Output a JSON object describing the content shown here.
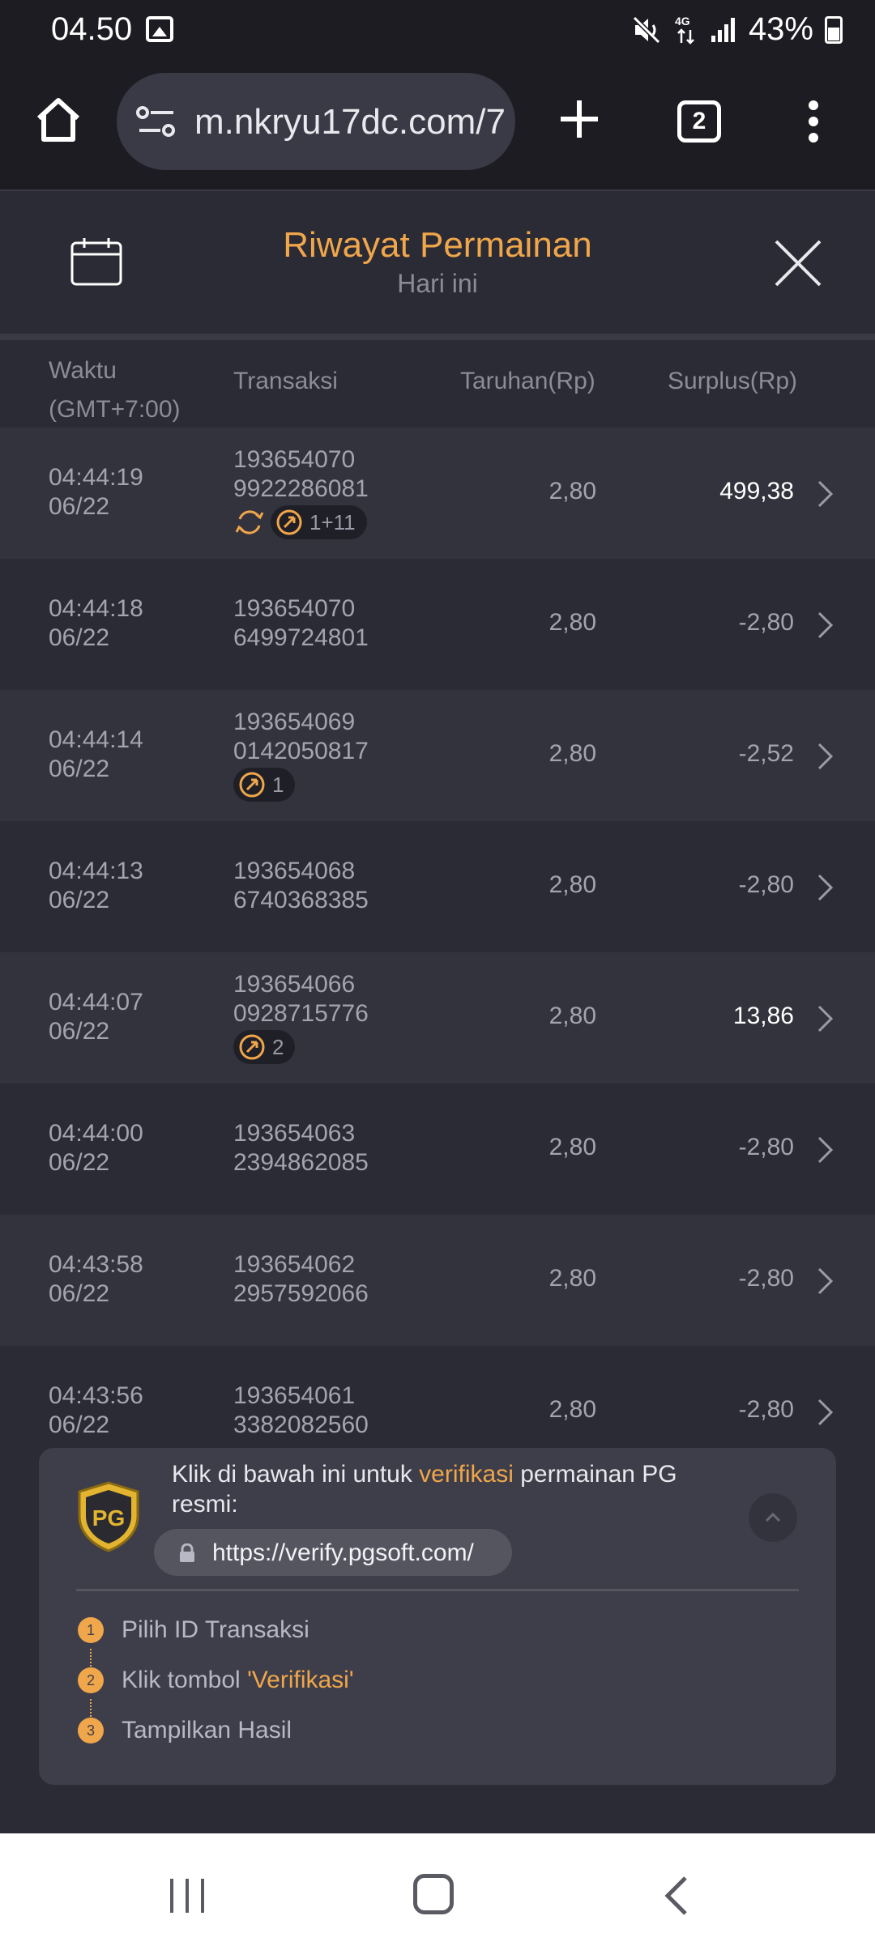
{
  "status_bar": {
    "time": "04.50",
    "network": "4G",
    "battery": "43%"
  },
  "browser": {
    "url": "m.nkryu17dc.com/7",
    "tab_count": "2"
  },
  "header": {
    "title": "Riwayat Permainan",
    "subtitle": "Hari ini"
  },
  "columns": {
    "time_line1": "Waktu",
    "time_line2": "(GMT+7:00)",
    "transaction": "Transaksi",
    "bet": "Taruhan(Rp)",
    "surplus": "Surplus(Rp)"
  },
  "rows": [
    {
      "time": "04:44:19",
      "date": "06/22",
      "tx1": "193654070",
      "tx2": "9922286081",
      "bet": "2,80",
      "surplus": "499,38",
      "badge": "1+11"
    },
    {
      "time": "04:44:18",
      "date": "06/22",
      "tx1": "193654070",
      "tx2": "6499724801",
      "bet": "2,80",
      "surplus": "-2,80"
    },
    {
      "time": "04:44:14",
      "date": "06/22",
      "tx1": "193654069",
      "tx2": "0142050817",
      "bet": "2,80",
      "surplus": "-2,52",
      "badge": "1"
    },
    {
      "time": "04:44:13",
      "date": "06/22",
      "tx1": "193654068",
      "tx2": "6740368385",
      "bet": "2,80",
      "surplus": "-2,80"
    },
    {
      "time": "04:44:07",
      "date": "06/22",
      "tx1": "193654066",
      "tx2": "0928715776",
      "bet": "2,80",
      "surplus": "13,86",
      "badge": "2"
    },
    {
      "time": "04:44:00",
      "date": "06/22",
      "tx1": "193654063",
      "tx2": "2394862085",
      "bet": "2,80",
      "surplus": "-2,80"
    },
    {
      "time": "04:43:58",
      "date": "06/22",
      "tx1": "193654062",
      "tx2": "2957592066",
      "bet": "2,80",
      "surplus": "-2,80"
    },
    {
      "time": "04:43:56",
      "date": "06/22",
      "tx1": "193654061",
      "tx2": "3382082560",
      "bet": "2,80",
      "surplus": "-2,80"
    }
  ],
  "verify": {
    "text_before": "Klik di bawah ini untuk ",
    "text_highlight": "verifikasi",
    "text_after": " permainan PG resmi:",
    "url": "https://verify.pgsoft.com/",
    "logo": "PG",
    "steps": [
      {
        "num": "1",
        "label": "Pilih ID Transaksi"
      },
      {
        "num": "2",
        "label": "Klik tombol ",
        "highlight": "'Verifikasi'"
      },
      {
        "num": "3",
        "label": "Tampilkan Hasil"
      }
    ]
  },
  "colors": {
    "accent": "#f0a64a",
    "background": "#2b2b35",
    "row_alt": "#33333e",
    "panel": "#3e3e4a"
  }
}
